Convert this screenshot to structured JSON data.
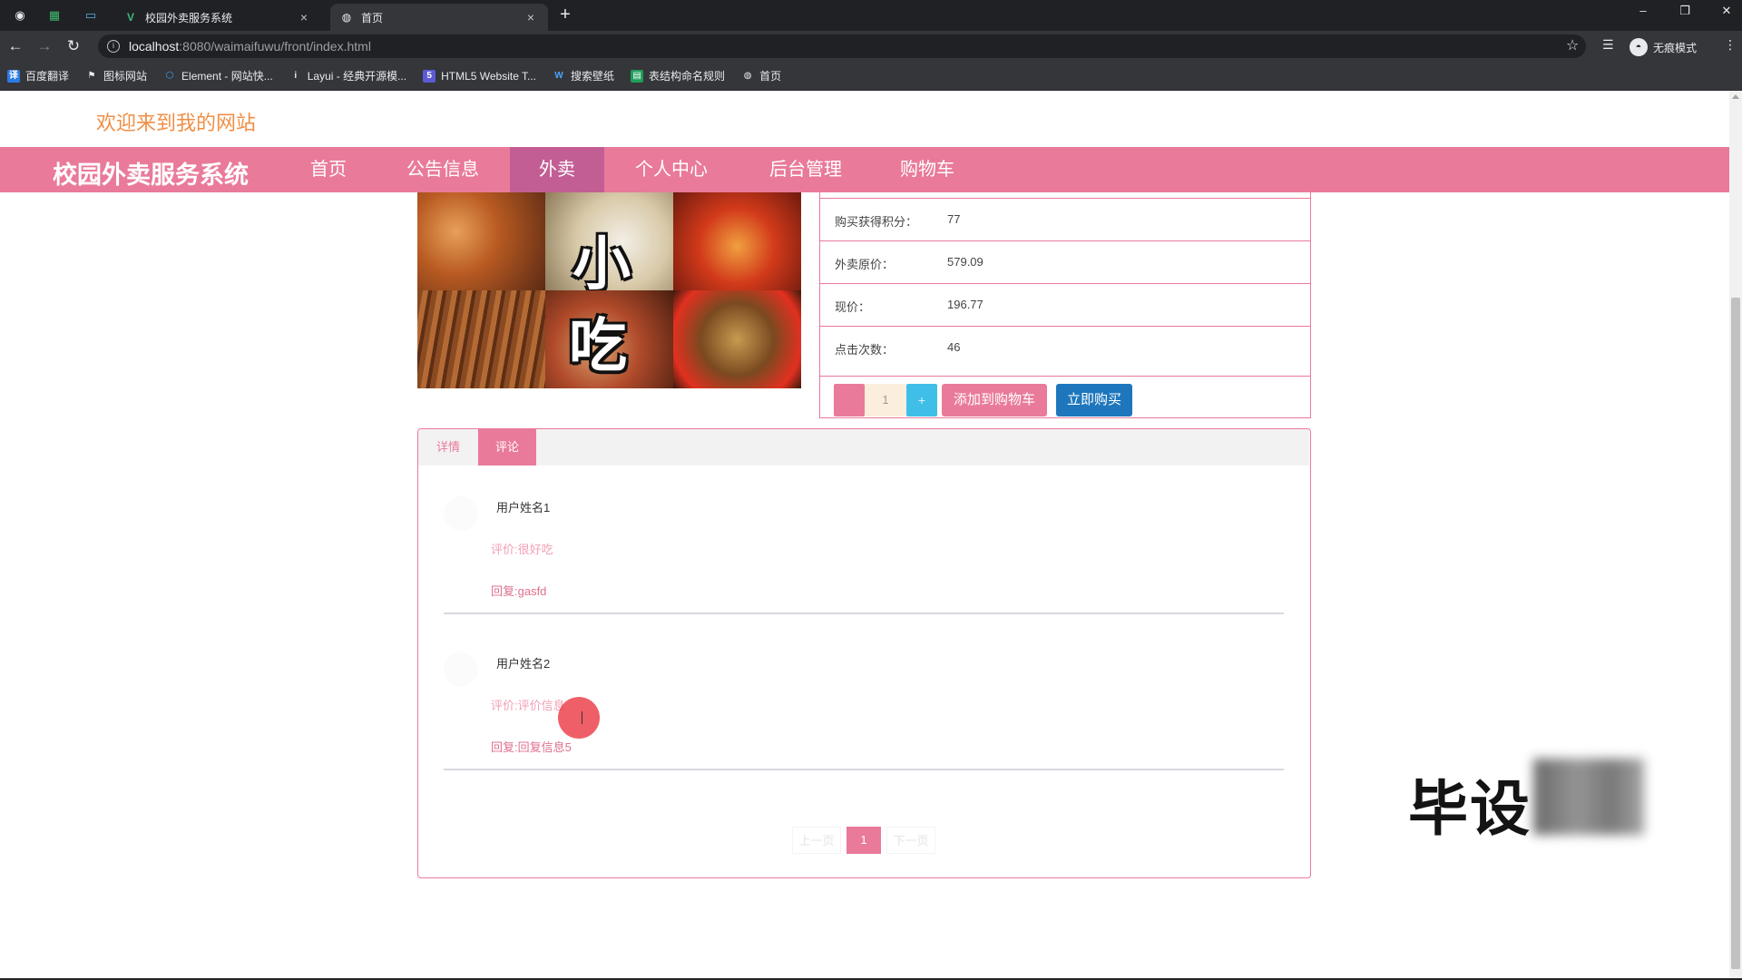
{
  "browser": {
    "tabs": [
      {
        "title": "校园外卖服务系统",
        "close": "×"
      },
      {
        "title": "首页",
        "close": "×"
      }
    ],
    "new_tab": "+",
    "url_host": "localhost",
    "url_path": ":8080/waimaifuwu/front/index.html",
    "profile_label": "无痕模式",
    "bookmarks": [
      "百度翻译",
      "图标网站",
      "Element - 网站快...",
      "Layui - 经典开源模...",
      "HTML5 Website T...",
      "搜索壁纸",
      "表结构命名规则",
      "首页"
    ]
  },
  "site": {
    "welcome": "欢迎来到我的网站",
    "brand": "校园外卖服务系统",
    "nav": [
      "首页",
      "公告信息",
      "外卖",
      "个人中心",
      "后台管理",
      "购物车"
    ],
    "active_nav": "外卖"
  },
  "product": {
    "image_text": [
      "小",
      "吃"
    ],
    "rows": [
      {
        "label": "购买获得积分：",
        "value": "77"
      },
      {
        "label": "外卖原价：",
        "value": "579.09"
      },
      {
        "label": "现价：",
        "value": "196.77"
      },
      {
        "label": "点击次数：",
        "value": "46"
      }
    ],
    "quantity": "1",
    "plus": "+",
    "add_to_cart": "添加到购物车",
    "buy_now": "立即购买"
  },
  "tabs": {
    "detail": "详情",
    "comments": "评论"
  },
  "comments": [
    {
      "user": "用户姓名1",
      "text": "评价:很好吃",
      "reply": "回复:gasfd"
    },
    {
      "user": "用户姓名2",
      "text": "评价:评价信息",
      "reply": "回复:回复信息5"
    }
  ],
  "pager": {
    "prev": "上一页",
    "current": "1",
    "next": "下一页"
  },
  "watermark": "毕设"
}
